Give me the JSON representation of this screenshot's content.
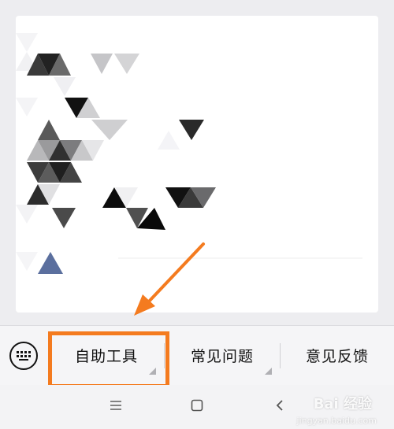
{
  "menu": {
    "items": [
      {
        "label": "自助工具"
      },
      {
        "label": "常见问题"
      },
      {
        "label": "意见反馈"
      }
    ]
  },
  "colors": {
    "highlight": "#f47b1f",
    "arrow": "#f47b1f",
    "accent_triangle": "#5b6f9e"
  },
  "icons": {
    "keyboard": "keyboard-icon",
    "nav_menu": "menu-lines-icon",
    "nav_home": "square-home-icon",
    "nav_back": "chevron-left-icon"
  },
  "watermark": {
    "brand": "Bai 经验",
    "sub": "jingyan.baidu.com"
  }
}
